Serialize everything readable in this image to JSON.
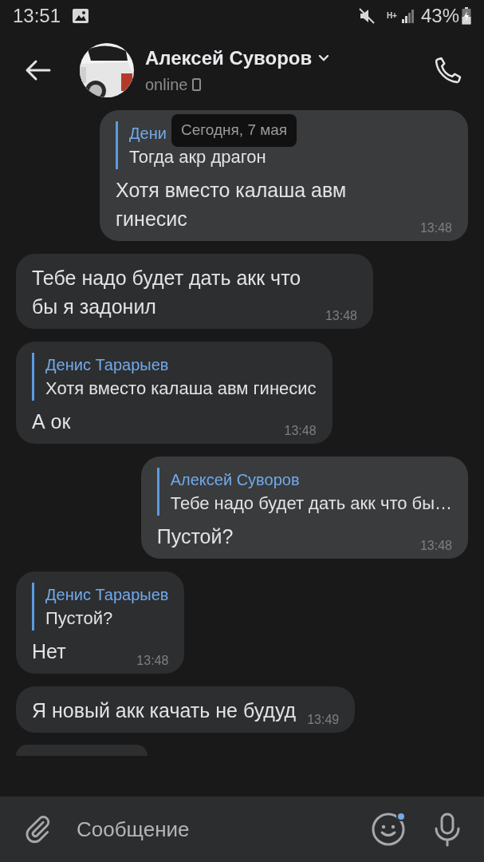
{
  "status_bar": {
    "time": "13:51",
    "network_type": "H+",
    "battery": "43%"
  },
  "header": {
    "name": "Алексей Суворов",
    "status": "online"
  },
  "date_badge": "Сегодня, 7 мая",
  "messages": [
    {
      "kind": "text",
      "outgoing": true,
      "reply": {
        "author": "Дени",
        "text": "Тогда акр драгон"
      },
      "text": "Хотя вместо калаша авм гинесис",
      "time": "13:48"
    },
    {
      "kind": "text",
      "outgoing": false,
      "text": "Тебе надо будет дать акк что бы я задонил",
      "time": "13:48"
    },
    {
      "kind": "text",
      "outgoing": false,
      "reply": {
        "author": "Денис Тарарыев",
        "text": "Хотя вместо калаша авм гинесис"
      },
      "text": "А ок",
      "time": "13:48"
    },
    {
      "kind": "text",
      "outgoing": true,
      "reply": {
        "author": "Алексей Суворов",
        "text": "Тебе надо будет дать акк что бы…"
      },
      "text": "Пустой?",
      "time": "13:48"
    },
    {
      "kind": "text",
      "outgoing": false,
      "reply": {
        "author": "Денис Тарарыев",
        "text": "Пустой?"
      },
      "text": "Нет",
      "time": "13:48"
    },
    {
      "kind": "text",
      "outgoing": false,
      "text": "Я новый акк качать не будуд",
      "time": "13:49"
    },
    {
      "kind": "cut",
      "outgoing": false
    }
  ],
  "composer": {
    "placeholder": "Сообщение",
    "emoji_badge": true
  }
}
